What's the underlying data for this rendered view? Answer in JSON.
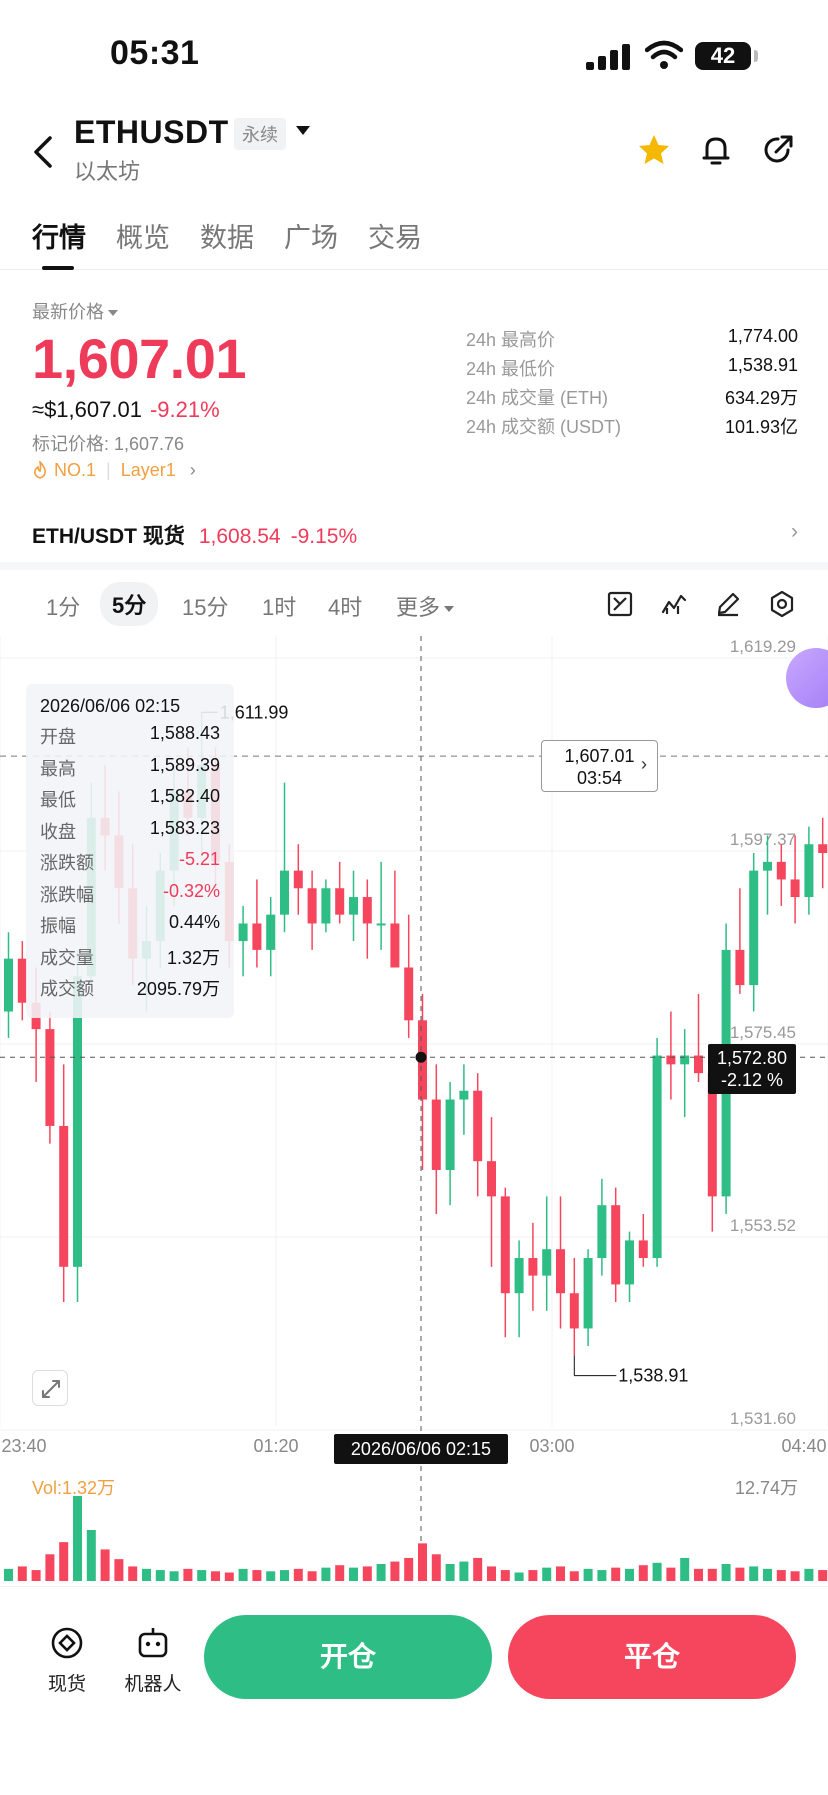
{
  "status": {
    "time": "05:31",
    "battery": "42"
  },
  "header": {
    "symbol": "ETHUSDT",
    "badge": "永续",
    "coin_name": "以太坊"
  },
  "tabs": [
    "行情",
    "概览",
    "数据",
    "广场",
    "交易"
  ],
  "price": {
    "label": "最新价格",
    "last": "1,607.01",
    "usd": "≈$1,607.01",
    "change_pct": "-9.21%",
    "mark": "标记价格: 1,607.76",
    "rank": "NO.1",
    "sector": "Layer1"
  },
  "stats": [
    {
      "k": "24h 最高价",
      "v": "1,774.00"
    },
    {
      "k": "24h 最低价",
      "v": "1,538.91"
    },
    {
      "k": "24h 成交量 (ETH)",
      "v": "634.29万"
    },
    {
      "k": "24h 成交额 (USDT)",
      "v": "101.93亿"
    }
  ],
  "spot": {
    "name": "ETH/USDT 现货",
    "price": "1,608.54",
    "pct": "-9.15%"
  },
  "intervals": [
    "1分",
    "5分",
    "15分",
    "1时",
    "4时",
    "更多"
  ],
  "ohlc": {
    "date": "2026/06/06 02:15",
    "rows": [
      {
        "k": "开盘",
        "v": "1,588.43"
      },
      {
        "k": "最高",
        "v": "1,589.39"
      },
      {
        "k": "最低",
        "v": "1,582.40"
      },
      {
        "k": "收盘",
        "v": "1,583.23"
      },
      {
        "k": "涨跌额",
        "v": "-5.21"
      },
      {
        "k": "涨跌幅",
        "v": "-0.32%"
      },
      {
        "k": "振幅",
        "v": "0.44%"
      },
      {
        "k": "成交量",
        "v": "1.32万"
      },
      {
        "k": "成交额",
        "v": "2095.79万"
      }
    ]
  },
  "chart_tags": {
    "last_price": "1,607.01",
    "countdown": "03:54",
    "cross_price": "1,572.80",
    "cross_pct": "-2.12 %",
    "cross_time": "2026/06/06 02:15",
    "high_label": "1,611.99",
    "low_label": "1,538.91"
  },
  "chart_data": {
    "type": "candlestick",
    "y_ticks": [
      "1,619.29",
      "1,597.37",
      "1,575.45",
      "1,553.52",
      "1,531.60"
    ],
    "ylim": [
      1531.6,
      1619.29
    ],
    "x_ticks": [
      "23:40",
      "01:20",
      "03:00",
      "04:40"
    ],
    "candles": [
      [
        1578,
        1587,
        1575,
        1584
      ],
      [
        1584,
        1586,
        1577,
        1579
      ],
      [
        1579,
        1583,
        1570,
        1576
      ],
      [
        1576,
        1578,
        1563,
        1565
      ],
      [
        1565,
        1572,
        1545,
        1549
      ],
      [
        1549,
        1585,
        1545,
        1582
      ],
      [
        1582,
        1604,
        1580,
        1600
      ],
      [
        1600,
        1606,
        1594,
        1598
      ],
      [
        1598,
        1603,
        1588,
        1592
      ],
      [
        1592,
        1597,
        1581,
        1584
      ],
      [
        1584,
        1590,
        1578,
        1586
      ],
      [
        1586,
        1596,
        1583,
        1594
      ],
      [
        1594,
        1606,
        1590,
        1603
      ],
      [
        1603,
        1608,
        1598,
        1600
      ],
      [
        1600,
        1612,
        1596,
        1606
      ],
      [
        1606,
        1608,
        1592,
        1595
      ],
      [
        1595,
        1597,
        1583,
        1586
      ],
      [
        1586,
        1590,
        1582,
        1588
      ],
      [
        1588,
        1593,
        1583,
        1585
      ],
      [
        1585,
        1591,
        1582,
        1589
      ],
      [
        1589,
        1604,
        1587,
        1594
      ],
      [
        1594,
        1597,
        1589,
        1592
      ],
      [
        1592,
        1594,
        1585,
        1588
      ],
      [
        1588,
        1593,
        1587,
        1592
      ],
      [
        1592,
        1595,
        1588,
        1589
      ],
      [
        1589,
        1594,
        1586,
        1591
      ],
      [
        1591,
        1593,
        1584,
        1588
      ],
      [
        1588,
        1595,
        1585,
        1588
      ],
      [
        1588,
        1594,
        1585,
        1583
      ],
      [
        1583,
        1589,
        1575,
        1577
      ],
      [
        1577,
        1580,
        1560,
        1568
      ],
      [
        1568,
        1572,
        1555,
        1560
      ],
      [
        1560,
        1570,
        1556,
        1568
      ],
      [
        1568,
        1572,
        1564,
        1569
      ],
      [
        1569,
        1571,
        1557,
        1561
      ],
      [
        1561,
        1566,
        1549,
        1557
      ],
      [
        1557,
        1558,
        1541,
        1546
      ],
      [
        1546,
        1552,
        1541,
        1550
      ],
      [
        1550,
        1554,
        1544,
        1548
      ],
      [
        1548,
        1557,
        1544,
        1551
      ],
      [
        1551,
        1557,
        1542,
        1546
      ],
      [
        1546,
        1550,
        1538.91,
        1542
      ],
      [
        1542,
        1551,
        1540,
        1550
      ],
      [
        1550,
        1559,
        1548,
        1556
      ],
      [
        1556,
        1558,
        1545,
        1547
      ],
      [
        1547,
        1553,
        1545,
        1552
      ],
      [
        1552,
        1555,
        1549,
        1550
      ],
      [
        1550,
        1575,
        1549,
        1573
      ],
      [
        1573,
        1578,
        1568,
        1572
      ],
      [
        1572,
        1576,
        1566,
        1573
      ],
      [
        1573,
        1580,
        1570,
        1571
      ],
      [
        1571,
        1574,
        1553,
        1557
      ],
      [
        1557,
        1588,
        1555,
        1585
      ],
      [
        1585,
        1592,
        1580,
        1581
      ],
      [
        1581,
        1596,
        1578,
        1594
      ],
      [
        1594,
        1598,
        1589,
        1595
      ],
      [
        1595,
        1597,
        1590,
        1593
      ],
      [
        1593,
        1598,
        1588,
        1591
      ],
      [
        1591,
        1599,
        1589,
        1597
      ],
      [
        1597,
        1600,
        1592,
        1596
      ]
    ],
    "volumes": [
      1.0,
      1.2,
      0.9,
      2.2,
      3.2,
      7.0,
      4.2,
      2.6,
      1.8,
      1.2,
      1.0,
      0.9,
      0.8,
      1.0,
      0.9,
      0.8,
      0.7,
      1.0,
      0.9,
      0.8,
      0.9,
      1.0,
      0.8,
      1.1,
      1.3,
      1.1,
      1.2,
      1.4,
      1.6,
      1.9,
      3.1,
      2.2,
      1.4,
      1.6,
      1.9,
      1.2,
      0.9,
      0.7,
      0.9,
      1.1,
      1.2,
      0.8,
      1.0,
      0.9,
      1.1,
      1.0,
      1.3,
      1.5,
      1.1,
      1.9,
      1.0,
      1.0,
      1.4,
      1.1,
      1.2,
      1.0,
      0.9,
      0.8,
      1.0,
      0.9
    ],
    "volume_label": "Vol:1.32万",
    "volume_max": "12.74万"
  },
  "bottom": {
    "spot_label": "现货",
    "robot_label": "机器人",
    "open_label": "开仓",
    "close_label": "平仓"
  },
  "colors": {
    "up": "#2ebd85",
    "down": "#f6465d",
    "accent": "#ef3b5a"
  }
}
